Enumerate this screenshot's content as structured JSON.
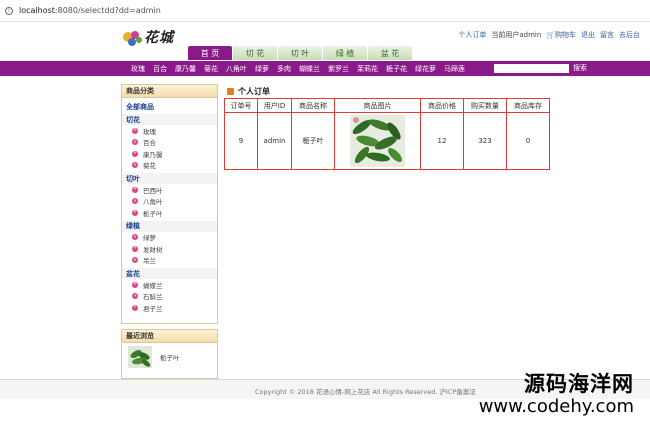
{
  "browser": {
    "url_host": "localhost",
    "url_rest": ":8080/selectdd?dd=admin"
  },
  "header": {
    "logo_text": "花城",
    "links": {
      "orders": "个人订单",
      "user": "当前用户admin",
      "cart": "购物车",
      "logout": "退出",
      "message": "留言",
      "admin": "去后台"
    }
  },
  "nav": {
    "tabs": [
      "首 页",
      "切 花",
      "切 叶",
      "绿 植",
      "盆 花"
    ]
  },
  "categories": [
    "玫瑰",
    "百合",
    "康乃馨",
    "菊花",
    "八角叶",
    "绿萝",
    "多肉",
    "蝴蝶兰",
    "紫罗兰",
    "茉莉花",
    "栀子花",
    "绿花萝",
    "马蹄莲"
  ],
  "search": {
    "button": "搜索",
    "placeholder": ""
  },
  "sidebar": {
    "title": "商品分类",
    "all": "全部商品",
    "groups": [
      {
        "name": "切花",
        "items": [
          "玫瑰",
          "百合",
          "康乃馨",
          "菊花"
        ]
      },
      {
        "name": "切叶",
        "items": [
          "巴西叶",
          "八角叶",
          "栀子叶"
        ]
      },
      {
        "name": "绿植",
        "items": [
          "绿萝",
          "发财树",
          "吊兰"
        ]
      },
      {
        "name": "盆花",
        "items": [
          "蝴蝶兰",
          "石斛兰",
          "君子兰"
        ]
      }
    ],
    "bullet": "»"
  },
  "recent": {
    "title": "最近浏览",
    "item_name": "栀子叶"
  },
  "main": {
    "title": "个人订单",
    "columns": [
      "订单号",
      "用户ID",
      "商品名称",
      "商品图片",
      "商品价格",
      "购买数量",
      "商品库存"
    ],
    "rows": [
      {
        "order_id": "9",
        "user_id": "admin",
        "name": "栀子叶",
        "price": "12",
        "quantity": "323",
        "stock": "0"
      }
    ]
  },
  "footer": {
    "copyright": "Copyright © 2018 花语心情-网上花店 All Rights Reserved. 沪ICP备案证"
  },
  "watermark": {
    "line1": "源码海洋网",
    "line2": "www.codehy.com"
  },
  "colors": {
    "brand_purple": "#8a1a8a",
    "table_border": "#e03b3b",
    "accent_orange": "#e87a20",
    "link_blue": "#3a5fa0"
  }
}
